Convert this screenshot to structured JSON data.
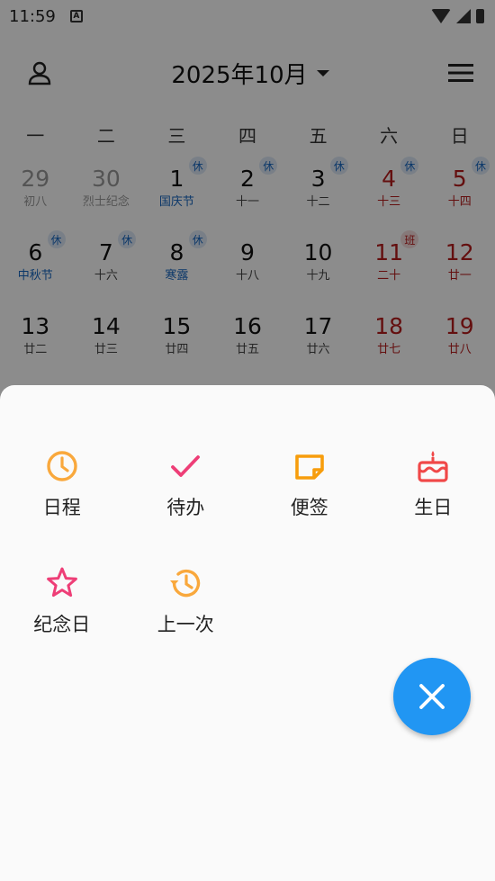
{
  "status_bar": {
    "time": "11:59",
    "notif_glyph": "A"
  },
  "header": {
    "month_title": "2025年10月"
  },
  "weekdays": [
    "一",
    "二",
    "三",
    "四",
    "五",
    "六",
    "日"
  ],
  "days": [
    {
      "num": "29",
      "lunar": "初八",
      "other": true
    },
    {
      "num": "30",
      "lunar": "烈士纪念",
      "other": true
    },
    {
      "num": "1",
      "lunar": "国庆节",
      "festival": true,
      "badge": "休"
    },
    {
      "num": "2",
      "lunar": "十一",
      "badge": "休"
    },
    {
      "num": "3",
      "lunar": "十二",
      "badge": "休"
    },
    {
      "num": "4",
      "lunar": "十三",
      "weekend": true,
      "badge": "休"
    },
    {
      "num": "5",
      "lunar": "十四",
      "weekend": true,
      "badge": "休"
    },
    {
      "num": "6",
      "lunar": "中秋节",
      "festival": true,
      "badge": "休"
    },
    {
      "num": "7",
      "lunar": "十六",
      "badge": "休"
    },
    {
      "num": "8",
      "lunar": "寒露",
      "festival": true,
      "badge": "休"
    },
    {
      "num": "9",
      "lunar": "十八"
    },
    {
      "num": "10",
      "lunar": "十九"
    },
    {
      "num": "11",
      "lunar": "二十",
      "weekend": true,
      "badge": "班",
      "badge_type": "work"
    },
    {
      "num": "12",
      "lunar": "廿一",
      "weekend": true
    },
    {
      "num": "13",
      "lunar": "廿二"
    },
    {
      "num": "14",
      "lunar": "廿三"
    },
    {
      "num": "15",
      "lunar": "廿四"
    },
    {
      "num": "16",
      "lunar": "廿五"
    },
    {
      "num": "17",
      "lunar": "廿六"
    },
    {
      "num": "18",
      "lunar": "廿七",
      "weekend": true
    },
    {
      "num": "19",
      "lunar": "廿八",
      "weekend": true
    }
  ],
  "sheet": {
    "actions": [
      {
        "label": "日程",
        "icon": "clock-icon",
        "color": "#f9a83c"
      },
      {
        "label": "待办",
        "icon": "check-icon",
        "color": "#ee3e77"
      },
      {
        "label": "便签",
        "icon": "note-icon",
        "color": "#f79d0c"
      },
      {
        "label": "生日",
        "icon": "cake-icon",
        "color": "#f04848"
      },
      {
        "label": "纪念日",
        "icon": "star-icon",
        "color": "#ee3e77"
      },
      {
        "label": "上一次",
        "icon": "history-icon",
        "color": "#f9a83c"
      }
    ]
  },
  "colors": {
    "fab": "#2196f3",
    "rest_badge": "#1565c0",
    "work_badge": "#b71c1c"
  }
}
